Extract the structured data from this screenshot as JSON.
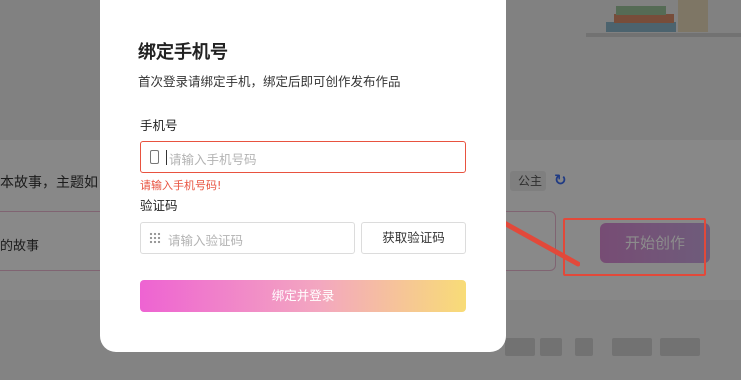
{
  "modal": {
    "title": "绑定手机号",
    "subtitle": "首次登录请绑定手机，绑定后即可创作发布作品",
    "phone_label": "手机号",
    "phone_placeholder": "请输入手机号码",
    "phone_error": "请输入手机号码!",
    "code_label": "验证码",
    "code_placeholder": "请输入验证码",
    "get_code_button": "获取验证码",
    "submit_button": "绑定并登录"
  },
  "background": {
    "prompt_text": "本故事，主题如",
    "tag_text": "公主",
    "input_text": "的故事",
    "start_button": "开始创作"
  },
  "colors": {
    "error": "#e8523f",
    "annotation": "#e2493a",
    "submit_gradient": [
      "#ee63d2",
      "#f3a7c0",
      "#f8dc77"
    ]
  },
  "icons": {
    "phone": "mobile-phone-icon",
    "code": "keypad-icon",
    "refresh": "refresh-icon"
  }
}
